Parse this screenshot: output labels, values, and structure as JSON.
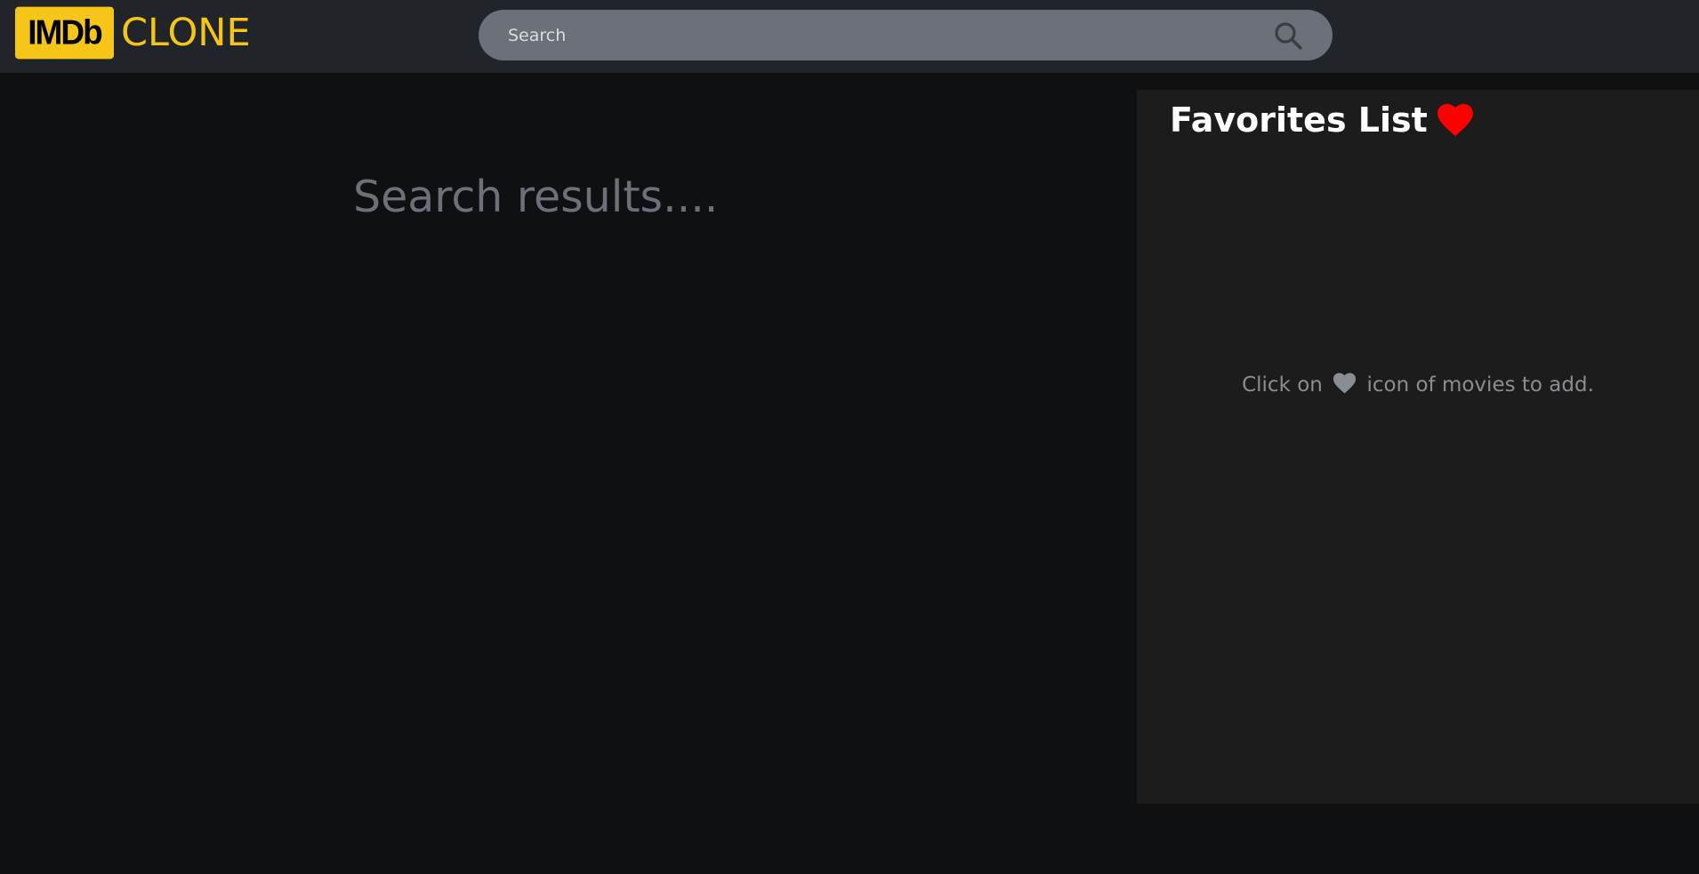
{
  "navbar": {
    "logo_badge": "IMDb",
    "logo_text": "CLONE",
    "search": {
      "placeholder": "Search",
      "value": "",
      "icon": "search-icon"
    }
  },
  "main": {
    "results_title": "Search results...."
  },
  "favorites": {
    "title": "Favorites List",
    "title_icon": "heart-icon",
    "hint_before": "Click on",
    "hint_icon": "heart-icon",
    "hint_after": "icon of movies to add."
  },
  "colors": {
    "brand_yellow": "#f5c518",
    "navbar_bg": "#212429",
    "page_bg": "#0f1011",
    "panel_bg": "#1c1c1d",
    "heart_red": "#ff0000",
    "muted_text": "#6c7078"
  }
}
